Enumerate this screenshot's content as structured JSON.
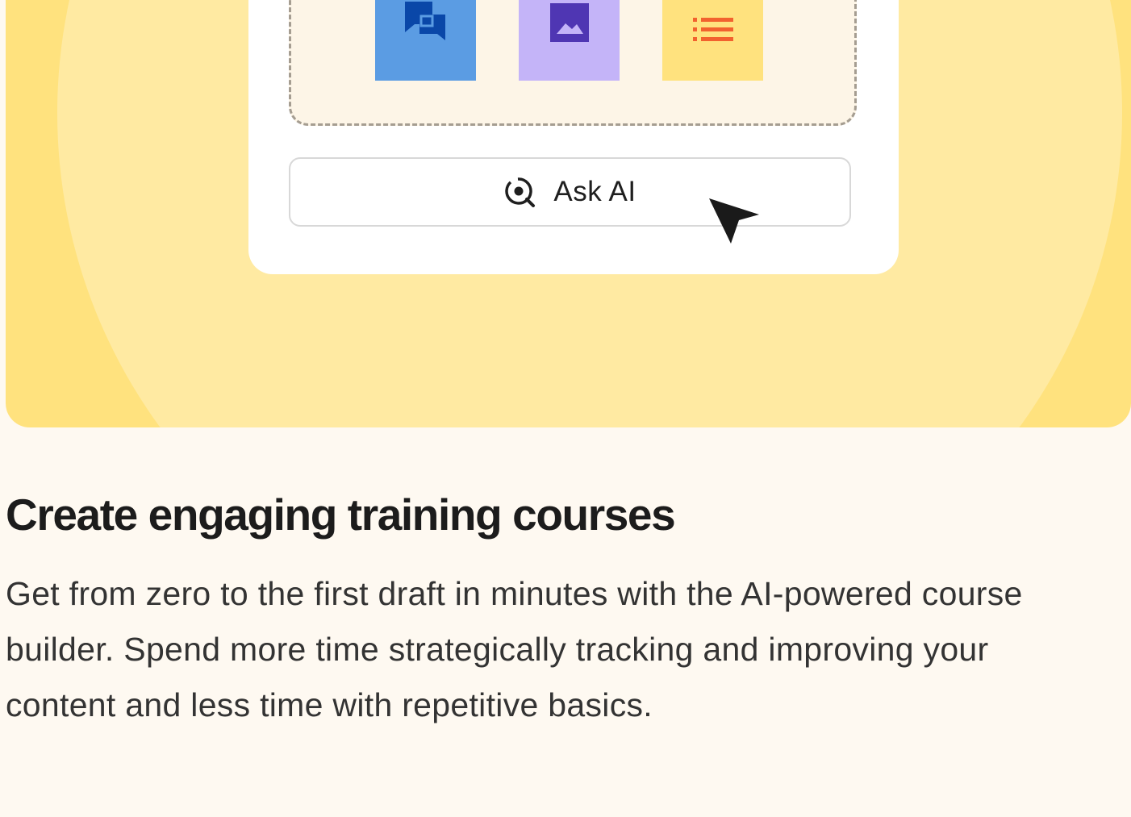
{
  "hero": {
    "ask_button": {
      "label": "Ask AI",
      "icon": "ai-search-icon"
    },
    "tiles": [
      {
        "icon": "chat-bubbles-icon",
        "color": "#5b9ce3"
      },
      {
        "icon": "image-icon",
        "color": "#c4b4f8"
      },
      {
        "icon": "list-icon",
        "color": "#ffe27e"
      }
    ],
    "cursor_icon": "mouse-pointer-icon"
  },
  "content": {
    "title": "Create engaging training courses",
    "description": "Get from zero to the first draft in minutes with the AI-powered course builder. Spend more time strategically tracking and improving your content and less time with repetitive basics."
  },
  "colors": {
    "hero_background": "#ffe27e",
    "hero_glow": "#ffeaa2",
    "page_background": "#fef9f1",
    "card_background": "#ffffff",
    "dropzone_background": "#fdf5e7",
    "chat_icon": "#0a47a8",
    "image_icon": "#4f36b3",
    "list_icon": "#f2622e"
  }
}
